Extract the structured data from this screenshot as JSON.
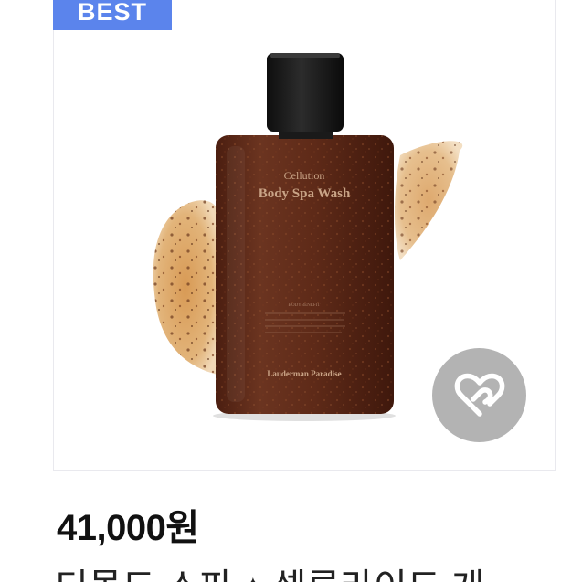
{
  "badge": {
    "label": "BEST"
  },
  "product": {
    "bottle_brand": "Cellution",
    "bottle_name": "Body Spa Wash",
    "bottle_subtitle": "BODYBENEFIT",
    "bottle_logo": "Lauderman Paradise"
  },
  "wishlist": {
    "icon": "heart-wish-icon"
  },
  "price": "41,000원",
  "title": "디몰드 스파 ♠ 셀루라이드 게"
}
